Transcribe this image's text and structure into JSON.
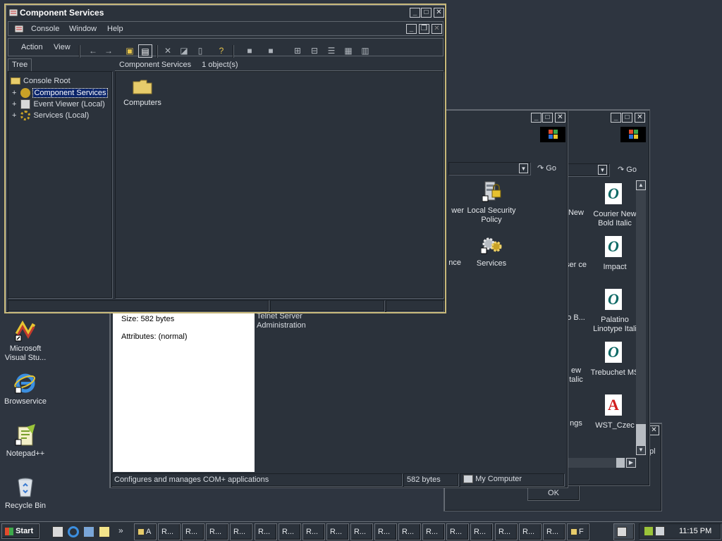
{
  "cs_window": {
    "title": "Component Services",
    "menu": {
      "console": "Console",
      "window": "Window",
      "help": "Help"
    },
    "action_menu": {
      "action": "Action",
      "view": "View"
    },
    "tree_tab": "Tree",
    "tree_items": [
      "Console Root",
      "Component Services",
      "Event Viewer (Local)",
      "Services (Local)"
    ],
    "list_header": "Component Services",
    "object_count": "1 object(s)",
    "list_items": [
      "Computers"
    ]
  },
  "admin_window": {
    "go_label": "Go",
    "icons": [
      "wer",
      "Local Security Policy",
      "nce",
      "Services"
    ],
    "left_pane": {
      "size": "Size: 582 bytes",
      "attributes": "Attributes: (normal)"
    },
    "partial_label": "Telnet Server Administration",
    "status": {
      "text": "Configures and manages COM+ applications",
      "size": "582 bytes",
      "zone": "My Computer"
    }
  },
  "fonts_window": {
    "go_label": "Go",
    "left_labels": [
      "New",
      "ser ce",
      "o B...",
      "ew talic",
      "ngs"
    ],
    "fonts": [
      "Courier New Bold Italic",
      "Impact",
      "Palatino Linotype Itali",
      "Trebuchet MS",
      "WST_Czec"
    ]
  },
  "dialog": {
    "ok_label": "OK",
    "partial": "pl"
  },
  "desktop_icons": [
    "Microsoft Visual Stu...",
    "Browservice",
    "Notepad++",
    "Recycle Bin"
  ],
  "taskbar": {
    "start_label": "Start",
    "chevron": "»",
    "tasks": [
      "A",
      "R...",
      "R...",
      "R...",
      "R...",
      "R...",
      "R...",
      "R...",
      "R...",
      "R...",
      "R...",
      "R...",
      "R...",
      "R...",
      "R...",
      "R...",
      "R...",
      "R...",
      "F"
    ],
    "clock": "11:15 PM"
  },
  "colors": {
    "desktop": "#2e3540",
    "window": "#2b323b",
    "selection": "#0a246a",
    "border": "#c8b97a"
  }
}
